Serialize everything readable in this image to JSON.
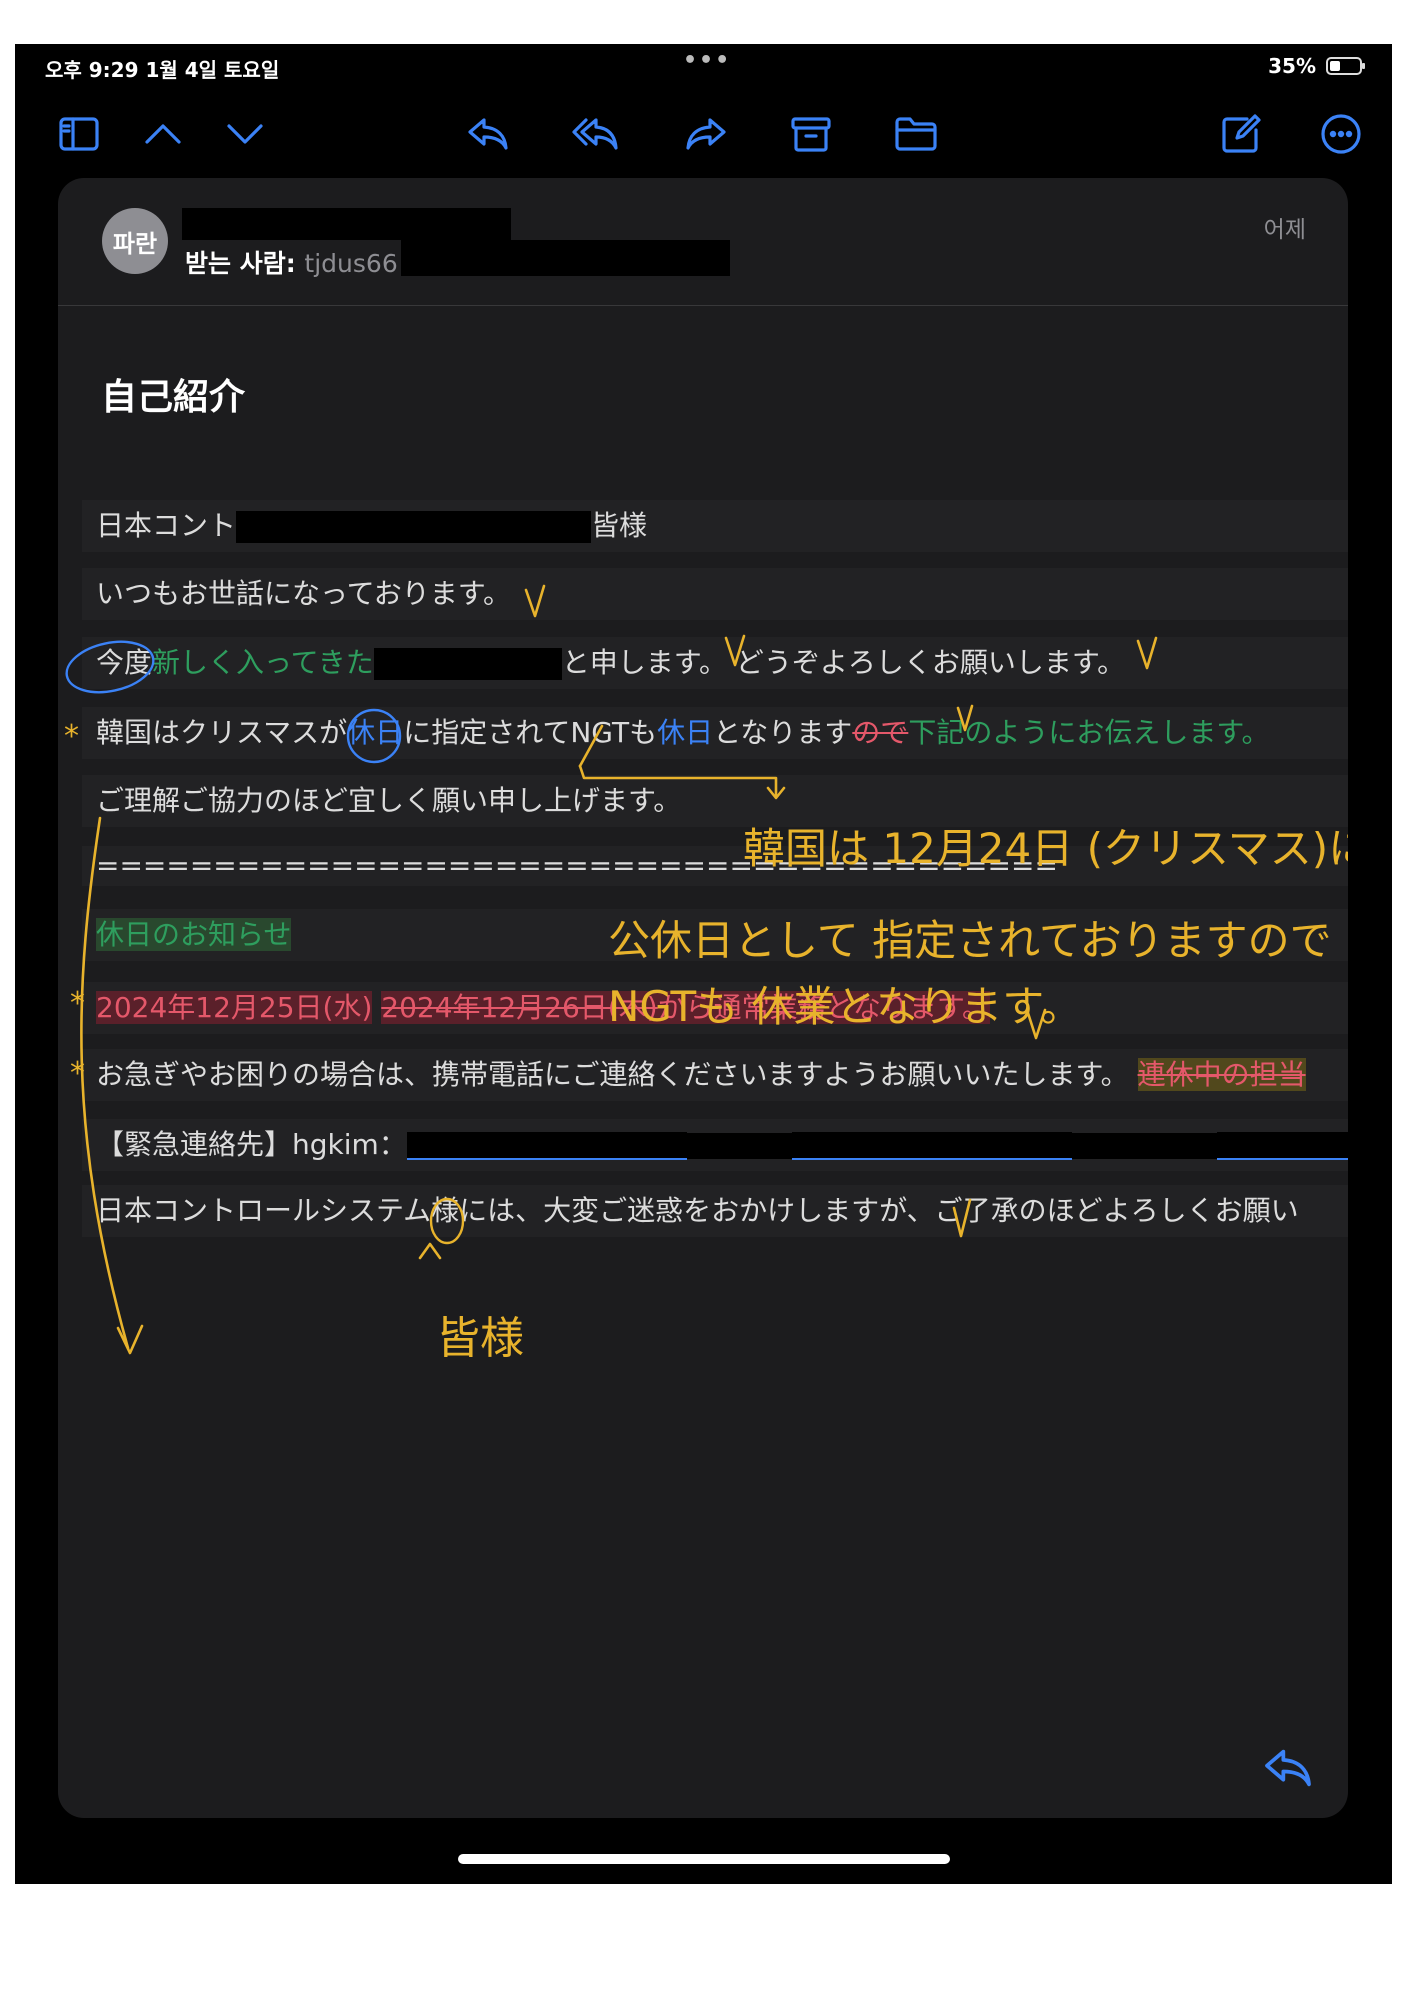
{
  "status_bar": {
    "time": "오후 9:29   1월 4일 토요일",
    "dots": "•••",
    "battery": "35%",
    "battery_level": 0.35
  },
  "toolbar": {
    "icons": [
      "sidebar-icon",
      "chevron-up-icon",
      "chevron-down-icon",
      "reply-icon",
      "reply-all-icon",
      "forward-icon",
      "archive-icon",
      "folder-icon",
      "compose-icon",
      "more-icon"
    ]
  },
  "email": {
    "avatar": "파란",
    "to_label": "받는 사람:",
    "to_address": "tjdus66",
    "date": "어제",
    "subject": "自己紹介",
    "lines": {
      "l1_a": "日本コント",
      "l1_b": "皆様",
      "l2": "いつもお世話になっております。",
      "l3_a": "今度",
      "l3_b": "新しく入ってきた",
      "l3_c": "と申します。",
      "l3_d": "どうぞよろしくお願いします。",
      "l4_a": "韓国はクリスマスが",
      "l4_b": "休日",
      "l4_c": "に指定されてNGTも",
      "l4_d": "休日",
      "l4_e": "となります",
      "l4_f": "ので",
      "l4_g": "下記のようにお伝えします。",
      "l5": "ご理解ご協力のほど宜しく願い申し上げます。",
      "l6": "=========================================",
      "l7": "休日のお知らせ",
      "l8_a": "2024年12月25日(水)",
      "l8_b": "2024年12月26日(木)",
      "l8_c": "から通常業務となります。",
      "l9_a": "お急ぎやお困りの場合は、携帯電話にご連絡くださいますようお願いいたします。",
      "l9_b": "連休中の担当",
      "l10_a": "【緊急連絡先】hgkim：",
      "l11": "日本コントロールシステム様には、大変ご迷惑をおかけしますが、ご了承のほどよろしくお願い"
    }
  },
  "annotations": {
    "ann1": "韓国は 12月24日 (クリスマス)に",
    "ann2": "公休日として 指定されておりますので",
    "ann3": "NGTも 休業となります。",
    "ann4": "皆様",
    "check": "V",
    "star": "*"
  },
  "colors": {
    "accent": "#3b82f6",
    "pen": "#e8b32c",
    "card": "#1c1c1e"
  }
}
